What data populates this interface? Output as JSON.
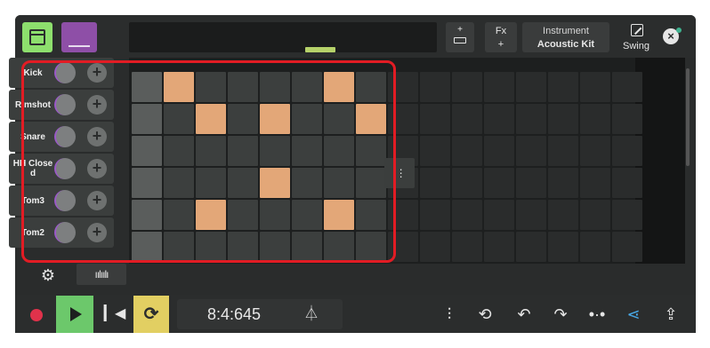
{
  "toolbar": {
    "keyboard_plus": "+",
    "fx_label": "Fx",
    "fx_plus": "+",
    "instrument_title": "Instrument",
    "instrument_name": "Acoustic Kit",
    "swing_label": "Swing",
    "close_icon": "⊗"
  },
  "tracks": [
    {
      "name": "Kick"
    },
    {
      "name": "Rimshot"
    },
    {
      "name": "Snare"
    },
    {
      "name": "HH Close d"
    },
    {
      "name": "Tom3"
    },
    {
      "name": "Tom2"
    }
  ],
  "pattern": {
    "steps_visible": 16,
    "active_steps": [
      [
        1,
        6
      ],
      [
        2,
        4,
        7
      ],
      [],
      [
        4
      ],
      [
        2,
        6
      ],
      []
    ]
  },
  "transport": {
    "position": "8:4:645"
  },
  "colors": {
    "active_step": "#e3a778",
    "accent_green": "#8ddf6d",
    "accent_purple": "#8e4fa7",
    "loop_yellow": "#e2cf62",
    "record_red": "#e0324b",
    "highlight_red": "#e21c24"
  },
  "icons": [
    "window-icon",
    "keyboard-icon",
    "swing-icon",
    "close-icon",
    "gear-icon",
    "waveform-icon",
    "record-icon",
    "play-icon",
    "skip-back-icon",
    "loop-icon",
    "metronome-icon",
    "mixer-icon",
    "sync-icon",
    "undo-icon",
    "redo-icon",
    "more-icon",
    "share-icon",
    "export-icon"
  ]
}
